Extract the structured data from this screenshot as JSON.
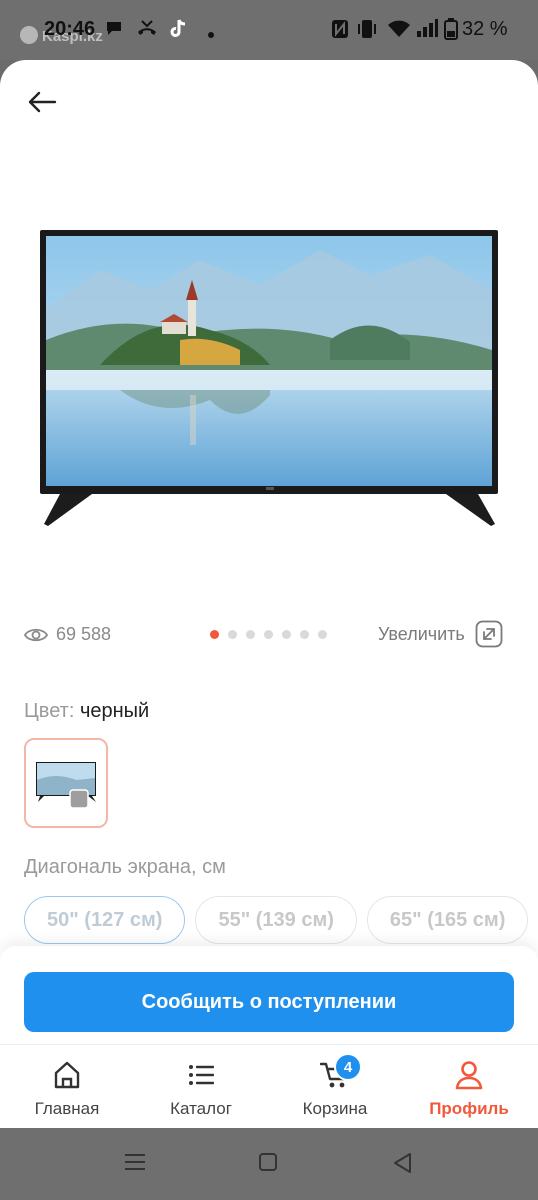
{
  "status_bar": {
    "time": "20:46",
    "watermark": "Kaspi.kz",
    "battery_percent": "32 %",
    "icons": [
      "chat-icon",
      "missed-call-icon",
      "tiktok-icon",
      "dot-icon",
      "nfc-icon",
      "vibrate-icon",
      "wifi-icon",
      "signal-icon",
      "battery-icon"
    ]
  },
  "product": {
    "views": "69 588",
    "gallery_total": 7,
    "gallery_active": 1,
    "zoom_label": "Увеличить"
  },
  "color": {
    "label": "Цвет:",
    "value": "черный"
  },
  "diagonal": {
    "label": "Диагональ экрана, см",
    "options": [
      "50\" (127 см)",
      "55\" (139 см)",
      "65\" (165 см)"
    ],
    "selected": 0
  },
  "cta": {
    "label": "Сообщить о поступлении"
  },
  "tabbar": {
    "home": "Главная",
    "catalog": "Каталог",
    "cart": "Корзина",
    "cart_badge": "4",
    "profile": "Профиль"
  },
  "colors": {
    "accent": "#1f90ee",
    "brand_orange": "#f1593a"
  }
}
